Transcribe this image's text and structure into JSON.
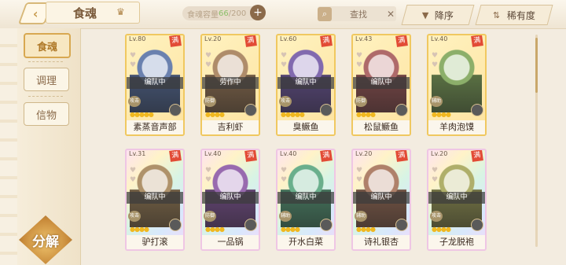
{
  "header": {
    "back_icon": "chevron-left-icon",
    "title": "食魂",
    "crown_icon": "crown-icon",
    "capacity_label": "食魂容量",
    "capacity_current": "66",
    "capacity_total": "/200",
    "capacity_add": "+",
    "search_placeholder": "查找",
    "search_clear": "✕",
    "sort_order_label": "降序",
    "sort_key_label": "稀有度"
  },
  "sidebar": {
    "tabs": [
      {
        "label": "食魂",
        "active": true
      },
      {
        "label": "调理",
        "active": false
      },
      {
        "label": "信物",
        "active": false
      }
    ],
    "decompose_label": "分解"
  },
  "cards": [
    {
      "level": "Lv.80",
      "full": "满",
      "status": "编队中",
      "role": "攻击",
      "name": "素蒸音声部",
      "rarity": "gold",
      "stars": 5
    },
    {
      "level": "Lv.20",
      "full": "满",
      "status": "劳作中",
      "role": "防御",
      "name": "吉利虾",
      "rarity": "gold",
      "stars": 4
    },
    {
      "level": "Lv.60",
      "full": "满",
      "status": "编队中",
      "role": "攻击",
      "name": "臭鳜鱼",
      "rarity": "gold",
      "stars": 5
    },
    {
      "level": "Lv.43",
      "full": "满",
      "status": "编队中",
      "role": "防御",
      "name": "松鼠鳜鱼",
      "rarity": "gold",
      "stars": 4
    },
    {
      "level": "Lv.40",
      "full": "满",
      "status": "",
      "role": "辅助",
      "name": "羊肉泡馍",
      "rarity": "gold",
      "stars": 4
    },
    {
      "level": "Lv.31",
      "full": "满",
      "status": "编队中",
      "role": "攻击",
      "name": "驴打滚",
      "rarity": "rainbow",
      "stars": 4
    },
    {
      "level": "Lv.40",
      "full": "满",
      "status": "编队中",
      "role": "防御",
      "name": "一品锅",
      "rarity": "rainbow",
      "stars": 4
    },
    {
      "level": "Lv.40",
      "full": "满",
      "status": "编队中",
      "role": "辅助",
      "name": "开水白菜",
      "rarity": "rainbow",
      "stars": 4
    },
    {
      "level": "Lv.20",
      "full": "满",
      "status": "编队中",
      "role": "辅助",
      "name": "诗礼银杏",
      "rarity": "rainbow",
      "stars": 4
    },
    {
      "level": "Lv.20",
      "full": "满",
      "status": "编队中",
      "role": "攻击",
      "name": "子龙脱袍",
      "rarity": "rainbow",
      "stars": 4
    }
  ],
  "colors": {
    "accent": "#d8a851",
    "status_bg": "#3c3c3c",
    "full_badge": "#e24b35"
  }
}
